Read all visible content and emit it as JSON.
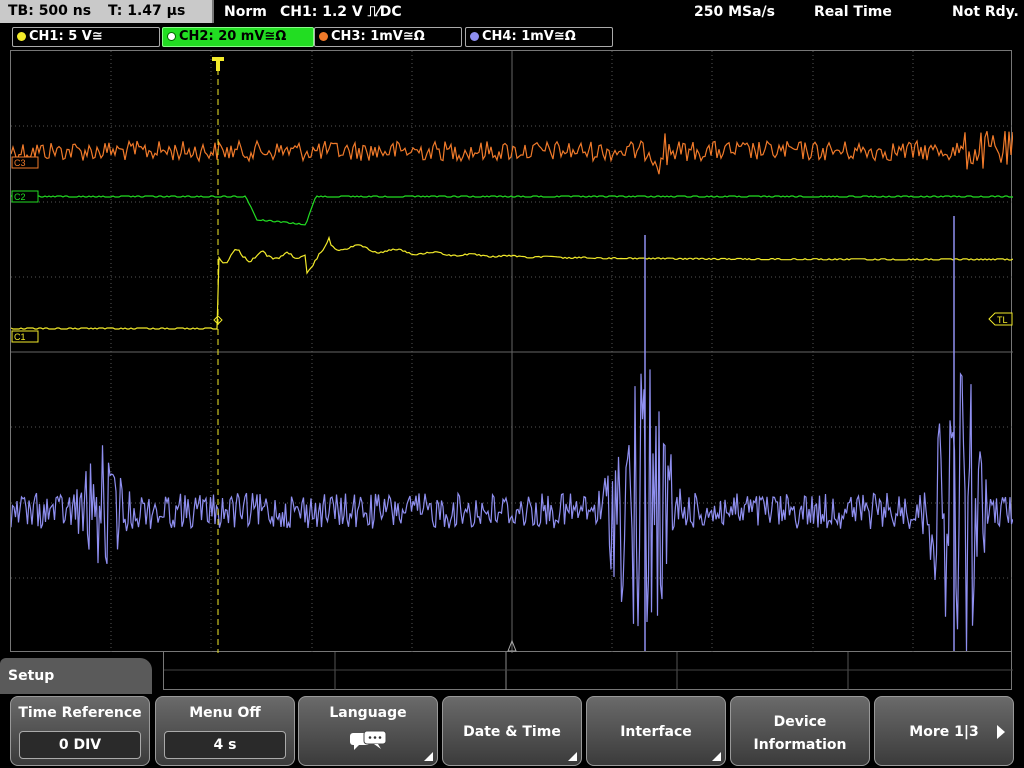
{
  "topbar": {
    "timebase": "TB: 500 ns",
    "trigger_time": "T: 1.47 µs",
    "trigger_mode": "Norm",
    "trigger_info": "CH1: 1.2 V ⎍⁄DC",
    "sample_rate": "250 MSa/s",
    "acq_mode": "Real Time",
    "status": "Not Rdy."
  },
  "channels": [
    {
      "label": "CH1: 5 V≅",
      "color": "#f2ea2a"
    },
    {
      "label": "CH2: 20 mV≅Ω",
      "color": "#22dd22"
    },
    {
      "label": "CH3: 1mV≅Ω",
      "color": "#f07a2a"
    },
    {
      "label": "CH4: 1mV≅Ω",
      "color": "#8f8ff0"
    }
  ],
  "screen": {
    "ch3_marker": "C3",
    "ch2_marker": "C2",
    "ch1_marker": "C1",
    "trigger_level_marker": "TL",
    "trigger_marker": "T"
  },
  "menu": {
    "tab": "Setup",
    "keys": [
      {
        "label": "Time Reference",
        "value": "0 DIV"
      },
      {
        "label": "Menu Off",
        "value": "4 s"
      },
      {
        "label": "Language",
        "icon": "speech-bubbles-icon"
      },
      {
        "label": "Date & Time"
      },
      {
        "label": "Interface"
      },
      {
        "label_line1": "Device",
        "label_line2": "Information"
      },
      {
        "label": "More 1|3"
      }
    ]
  },
  "colors": {
    "ch1": "#f2ea2a",
    "ch2": "#22dd22",
    "ch3": "#f07a2a",
    "ch4": "#8f8ff0",
    "grid": "#555555"
  }
}
